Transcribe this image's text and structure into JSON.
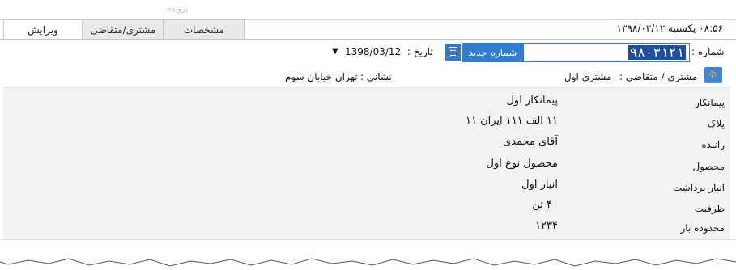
{
  "top_faded_text": "پرونده",
  "datetime": "۰۸:۵۶  یکشنبه ۱۳۹۸/۰۳/۱۲",
  "tabs": [
    {
      "label": "ویرایش"
    },
    {
      "label": "مشتری/متقاضی"
    },
    {
      "label": "مشخصات"
    }
  ],
  "form": {
    "number_label": "شماره :",
    "number_value": "۹۸۰۳۱۲۱",
    "new_number_button": "شماره جدید",
    "date_label": "تاریخ :",
    "date_value": "1398/03/12",
    "customer_label": "مشتری / متقاضی :",
    "customer_value": "مشتری اول",
    "address_label": "نشانی :",
    "address_value": "تهران خیابان سوم"
  },
  "details": [
    {
      "key": "پیمانکار",
      "value": "پیمانکار اول"
    },
    {
      "key": "پلاک",
      "value": "۱۱ الف ۱۱۱ ایران ۱۱"
    },
    {
      "key": "راننده",
      "value": "آقای محمدی"
    },
    {
      "key": "محصول",
      "value": "محصول نوع اول"
    },
    {
      "key": "انبار برداشت",
      "value": "انبار اول"
    },
    {
      "key": "ظرفیت",
      "value": "۴۰ تن"
    },
    {
      "key": "محدوده بار",
      "value": "۱۲۳۴"
    }
  ],
  "colors": {
    "accent": "#2f7cd0",
    "selection": "#1e4f9c"
  },
  "icons": {
    "new_number": "calculator-icon",
    "customer": "people-icon",
    "date": "chevron-down-icon"
  }
}
